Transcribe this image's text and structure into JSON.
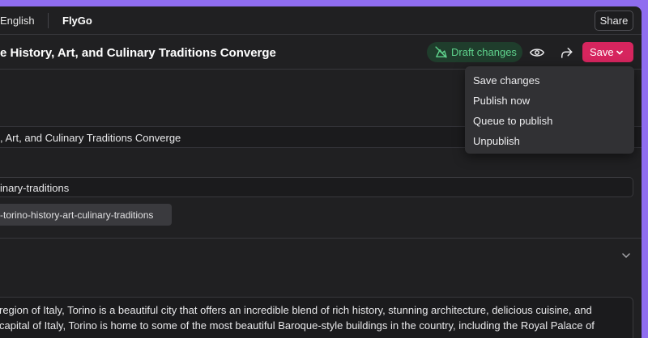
{
  "topbar": {
    "language": "English",
    "brand": "FlyGo",
    "share_label": "Share"
  },
  "header": {
    "title": "e History, Art, and Culinary Traditions Converge",
    "draft_badge": "Draft changes",
    "save_label": "Save",
    "icons": [
      "eye-icon",
      "share-arrow-icon",
      "chevron-down-icon",
      "cloud-off-icon"
    ]
  },
  "save_menu": {
    "items": [
      "Save changes",
      "Publish now",
      "Queue to publish",
      "Unpublish"
    ]
  },
  "form": {
    "title_value": ", Art, and Culinary Traditions Converge",
    "slug_value": "inary-traditions",
    "slug_chip": "-torino-history-art-culinary-traditions",
    "body_lines": [
      "region of Italy, Torino is a beautiful city that offers an incredible blend of rich history, stunning architecture, delicious cuisine, and",
      "capital of Italy, Torino is home to some of the most beautiful Baroque-style buildings in the country, including the Royal Palace of"
    ]
  },
  "colors": {
    "window_bg": "#202022",
    "accent_save": "#d6255e",
    "draft_green": "#5fd38d",
    "frame_purple": "#8f6df0"
  }
}
